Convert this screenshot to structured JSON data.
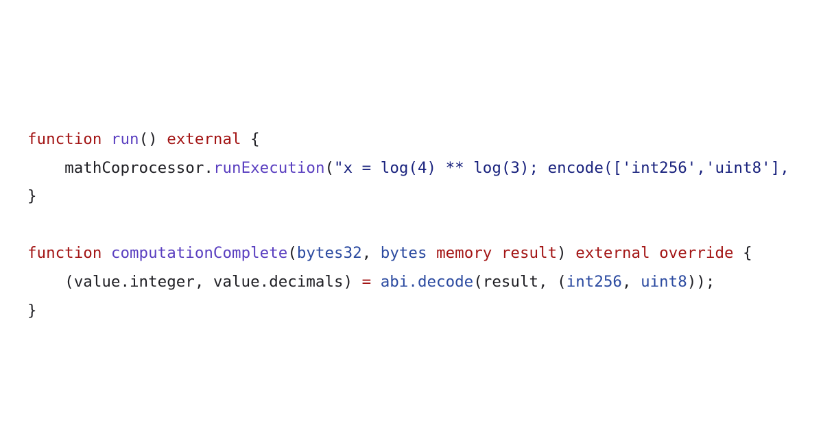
{
  "colors": {
    "keyword": "#a31515",
    "function_name": "#5a3fc0",
    "type": "#2b4aa0",
    "string": "#1a237e",
    "plain": "#1f1f24",
    "background": "#ffffff"
  },
  "code": {
    "language": "solidity",
    "lines": [
      {
        "tokens": [
          {
            "text": "function",
            "kind": "keyword"
          },
          {
            "text": " ",
            "kind": "plain"
          },
          {
            "text": "run",
            "kind": "function_name"
          },
          {
            "text": "() ",
            "kind": "plain"
          },
          {
            "text": "external",
            "kind": "keyword"
          },
          {
            "text": " {",
            "kind": "plain"
          }
        ]
      },
      {
        "tokens": [
          {
            "text": "    mathCoprocessor.",
            "kind": "plain"
          },
          {
            "text": "runExecution",
            "kind": "function_name"
          },
          {
            "text": "(",
            "kind": "plain"
          },
          {
            "text": "\"x = log(4) ** log(3); encode(['int256','uint8'],",
            "kind": "string"
          }
        ]
      },
      {
        "tokens": [
          {
            "text": "}",
            "kind": "plain"
          }
        ]
      },
      {
        "tokens": []
      },
      {
        "tokens": [
          {
            "text": "function",
            "kind": "keyword"
          },
          {
            "text": " ",
            "kind": "plain"
          },
          {
            "text": "computationComplete",
            "kind": "function_name"
          },
          {
            "text": "(",
            "kind": "plain"
          },
          {
            "text": "bytes32",
            "kind": "type"
          },
          {
            "text": ", ",
            "kind": "plain"
          },
          {
            "text": "bytes",
            "kind": "type"
          },
          {
            "text": " ",
            "kind": "plain"
          },
          {
            "text": "memory",
            "kind": "keyword"
          },
          {
            "text": " ",
            "kind": "plain"
          },
          {
            "text": "result",
            "kind": "keyword"
          },
          {
            "text": ") ",
            "kind": "plain"
          },
          {
            "text": "external",
            "kind": "keyword"
          },
          {
            "text": " ",
            "kind": "plain"
          },
          {
            "text": "override",
            "kind": "keyword"
          },
          {
            "text": " {",
            "kind": "plain"
          }
        ]
      },
      {
        "tokens": [
          {
            "text": "    (value.integer, value.decimals) ",
            "kind": "plain"
          },
          {
            "text": "=",
            "kind": "keyword"
          },
          {
            "text": " ",
            "kind": "plain"
          },
          {
            "text": "abi.decode",
            "kind": "type"
          },
          {
            "text": "(result, (",
            "kind": "plain"
          },
          {
            "text": "int256",
            "kind": "type"
          },
          {
            "text": ", ",
            "kind": "plain"
          },
          {
            "text": "uint8",
            "kind": "type"
          },
          {
            "text": "));",
            "kind": "plain"
          }
        ]
      },
      {
        "tokens": [
          {
            "text": "}",
            "kind": "plain"
          }
        ]
      }
    ]
  }
}
